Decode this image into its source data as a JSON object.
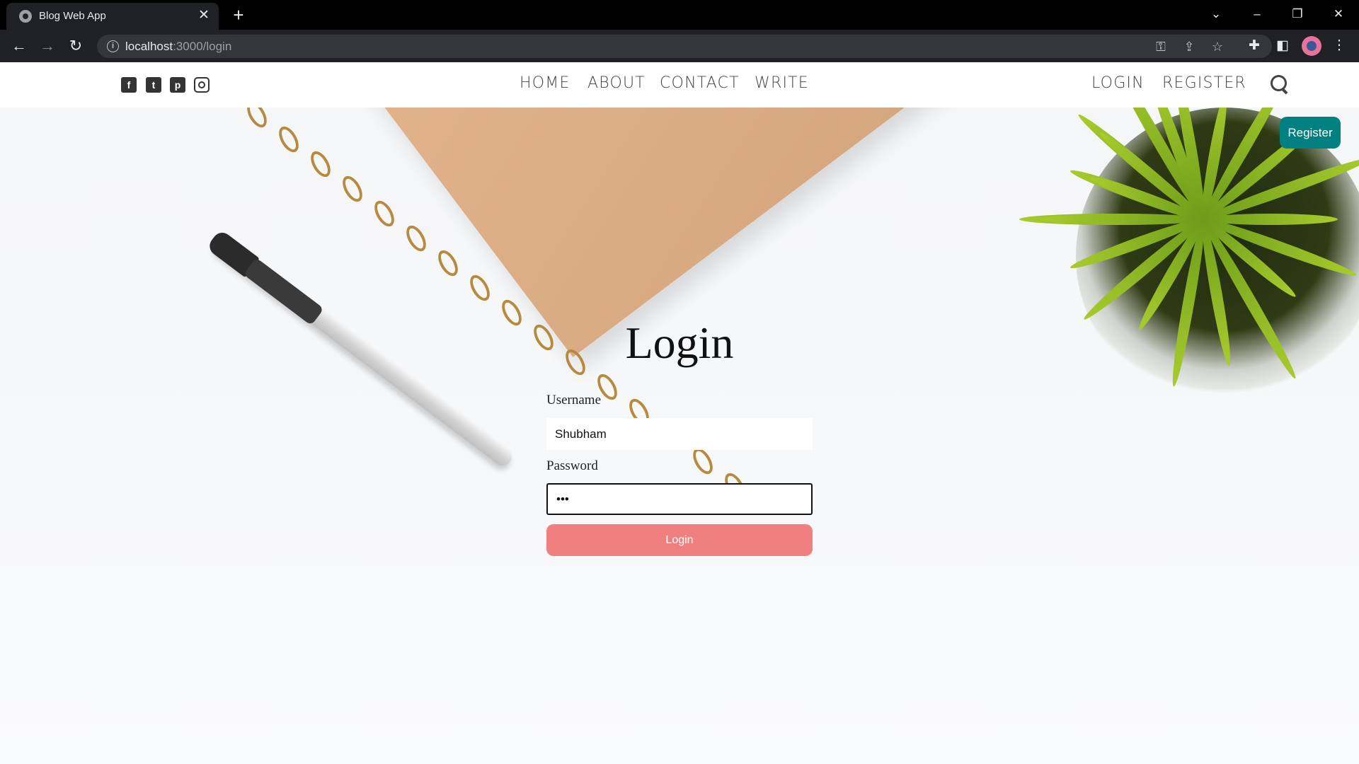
{
  "browser": {
    "tab_title": "Blog Web App",
    "url_host": "localhost",
    "url_path": ":3000/login"
  },
  "nav": {
    "social": [
      "facebook-icon",
      "twitter-icon",
      "pinterest-icon",
      "instagram-icon"
    ],
    "center": [
      "HOME",
      "ABOUT",
      "CONTACT",
      "WRITE"
    ],
    "right": [
      "LOGIN",
      "REGISTER"
    ]
  },
  "login": {
    "title": "Login",
    "username_label": "Username",
    "username_value": "Shubham",
    "password_label": "Password",
    "password_value": "•••",
    "button_label": "Login"
  },
  "register_button": "Register",
  "colors": {
    "login_button": "#f08080",
    "register_button": "#008080"
  }
}
